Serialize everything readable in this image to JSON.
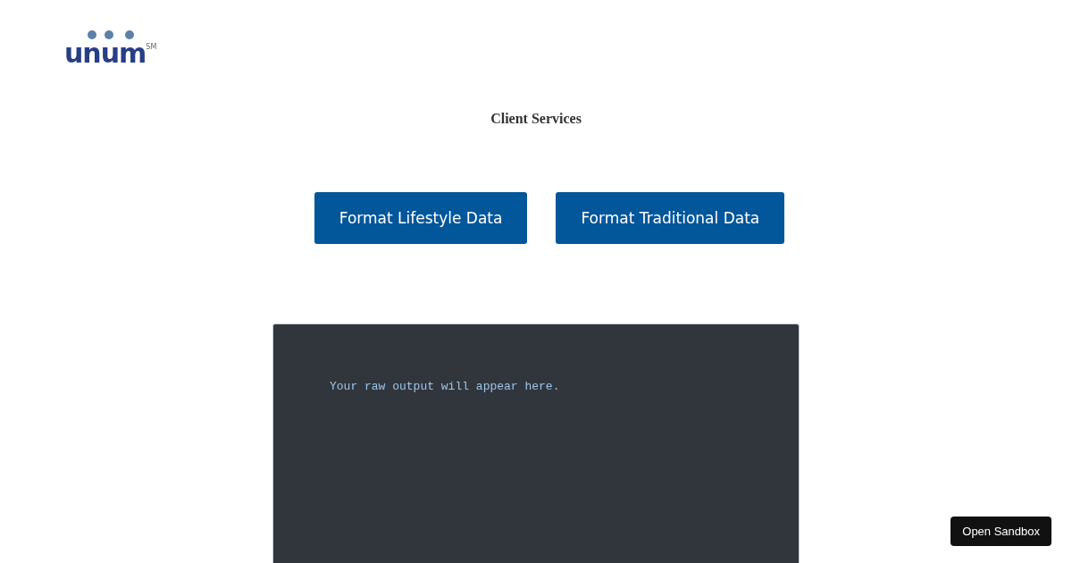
{
  "logo": {
    "text": "unum",
    "mark": "SM"
  },
  "title": "Client Services",
  "buttons": [
    "Format Lifestyle Data",
    "Format Traditional Data"
  ],
  "output": {
    "text": "Your raw output will appear here."
  },
  "sandbox_button": "Open Sandbox"
}
